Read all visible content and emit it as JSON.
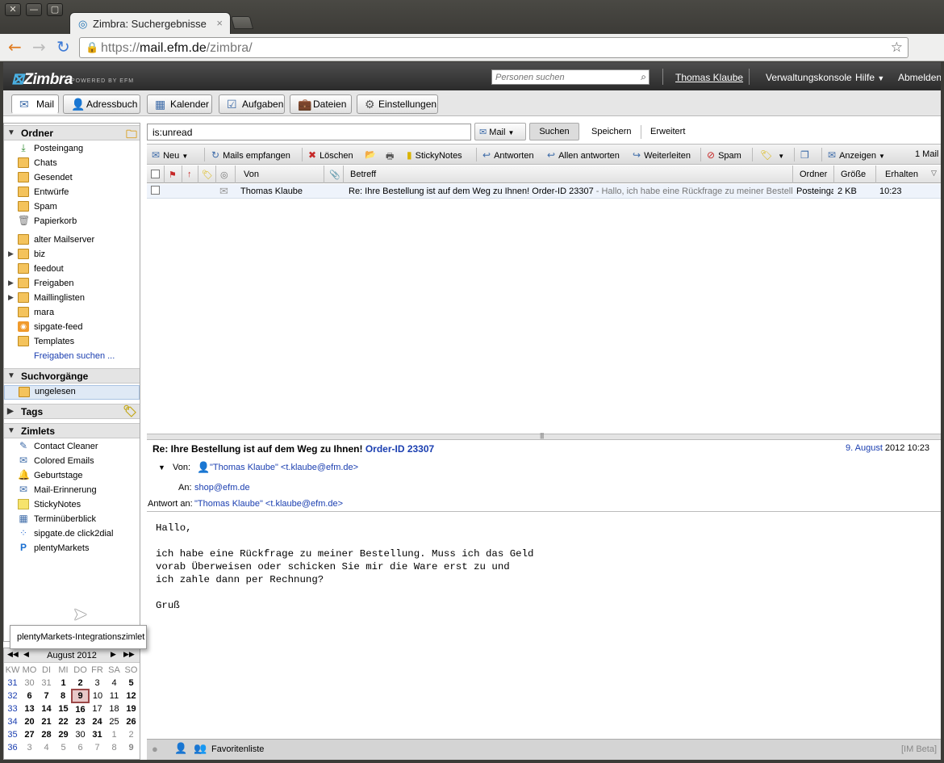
{
  "browser": {
    "tab_title": "Zimbra: Suchergebnisse",
    "tab_close": "×",
    "url_scheme": "https://",
    "url_host": "mail.efm.de",
    "url_path": "/zimbra/"
  },
  "header": {
    "logo": "Zimbra",
    "logo_sub": "POWERED BY EFM",
    "people_search_placeholder": "Personen suchen",
    "user": "Thomas Klaube",
    "admin_console": "Verwaltungskonsole",
    "help": "Hilfe",
    "logout": "Abmelden"
  },
  "app_tabs": [
    {
      "label": "Mail"
    },
    {
      "label": "Adressbuch"
    },
    {
      "label": "Kalender"
    },
    {
      "label": "Aufgaben"
    },
    {
      "label": "Dateien"
    },
    {
      "label": "Einstellungen"
    }
  ],
  "folders": {
    "title": "Ordner",
    "system": [
      {
        "label": "Posteingang"
      },
      {
        "label": "Chats"
      },
      {
        "label": "Gesendet"
      },
      {
        "label": "Entwürfe"
      },
      {
        "label": "Spam"
      },
      {
        "label": "Papierkorb"
      }
    ],
    "user": [
      {
        "label": "alter Mailserver"
      },
      {
        "label": "biz"
      },
      {
        "label": "feedout"
      },
      {
        "label": "Freigaben"
      },
      {
        "label": "Maillinglisten"
      },
      {
        "label": "mara"
      },
      {
        "label": "sipgate-feed"
      },
      {
        "label": "Templates"
      }
    ],
    "find_shares": "Freigaben suchen ..."
  },
  "searches": {
    "title": "Suchvorgänge",
    "items": [
      {
        "label": "ungelesen"
      }
    ]
  },
  "tags": {
    "title": "Tags"
  },
  "zimlets": {
    "title": "Zimlets",
    "items": [
      {
        "label": "Contact Cleaner"
      },
      {
        "label": "Colored Emails"
      },
      {
        "label": "Geburtstage"
      },
      {
        "label": "Mail-Erinnerung"
      },
      {
        "label": "StickyNotes"
      },
      {
        "label": "Terminüberblick"
      },
      {
        "label": "sipgate.de click2dial"
      },
      {
        "label": "plentyMarkets"
      }
    ],
    "tooltip": "plentyMarkets-Integrationszimlet"
  },
  "calendar": {
    "title": "August 2012",
    "week_header": "KW",
    "days": [
      "MO",
      "DI",
      "MI",
      "DO",
      "FR",
      "SA",
      "SO"
    ],
    "weeks": [
      {
        "kw": "31",
        "d": [
          "30",
          "31",
          "1",
          "2",
          "3",
          "4",
          "5"
        ]
      },
      {
        "kw": "32",
        "d": [
          "6",
          "7",
          "8",
          "9",
          "10",
          "11",
          "12"
        ]
      },
      {
        "kw": "33",
        "d": [
          "13",
          "14",
          "15",
          "16",
          "17",
          "18",
          "19"
        ]
      },
      {
        "kw": "34",
        "d": [
          "20",
          "21",
          "22",
          "23",
          "24",
          "25",
          "26"
        ]
      },
      {
        "kw": "35",
        "d": [
          "27",
          "28",
          "29",
          "30",
          "31",
          "1",
          "2"
        ]
      },
      {
        "kw": "36",
        "d": [
          "3",
          "4",
          "5",
          "6",
          "7",
          "8",
          "9"
        ]
      }
    ]
  },
  "search": {
    "query": "is:unread",
    "scope": "Mail",
    "search_btn": "Suchen",
    "save_btn": "Speichern",
    "advanced_btn": "Erweitert"
  },
  "toolbar": {
    "new": "Neu",
    "get_mail": "Mails empfangen",
    "delete": "Löschen",
    "sticky": "StickyNotes",
    "reply": "Antworten",
    "reply_all": "Allen antworten",
    "forward": "Weiterleiten",
    "spam": "Spam",
    "view": "Anzeigen",
    "count": "1 Mail"
  },
  "columns": {
    "from": "Von",
    "subject": "Betreff",
    "folder": "Ordner",
    "size": "Größe",
    "received": "Erhalten"
  },
  "messages": [
    {
      "from": "Thomas Klaube",
      "subject": "Re: Ihre Bestellung ist auf dem Weg zu Ihnen! Order-ID 23307",
      "fragment": " - Hallo, ich habe eine Rückfrage zu meiner Bestellu",
      "folder": "Posteinga",
      "size": "2 KB",
      "received": "10:23"
    }
  ],
  "reading": {
    "subject": "Re: Ihre Bestellung ist auf dem Weg zu Ihnen! ",
    "order_id": "Order-ID 23307",
    "date_link": "9. August",
    "date_rest": " 2012 10:23",
    "from_label": "Von:",
    "from_value": "\"Thomas Klaube\" <t.klaube@efm.de>",
    "to_label": "An:",
    "to_value": "shop@efm.de",
    "reply_label": "Antwort an:",
    "reply_value": "\"Thomas Klaube\" <t.klaube@efm.de>",
    "body": "Hallo,\n\nich habe eine Rückfrage zu meiner Bestellung. Muss ich das Geld\nvorab Überweisen oder schicken Sie mir die Ware erst zu und\nich zahle dann per Rechnung?\n\nGruß"
  },
  "im": {
    "buddy_list": "Favoritenliste",
    "beta": "[IM Beta]"
  }
}
